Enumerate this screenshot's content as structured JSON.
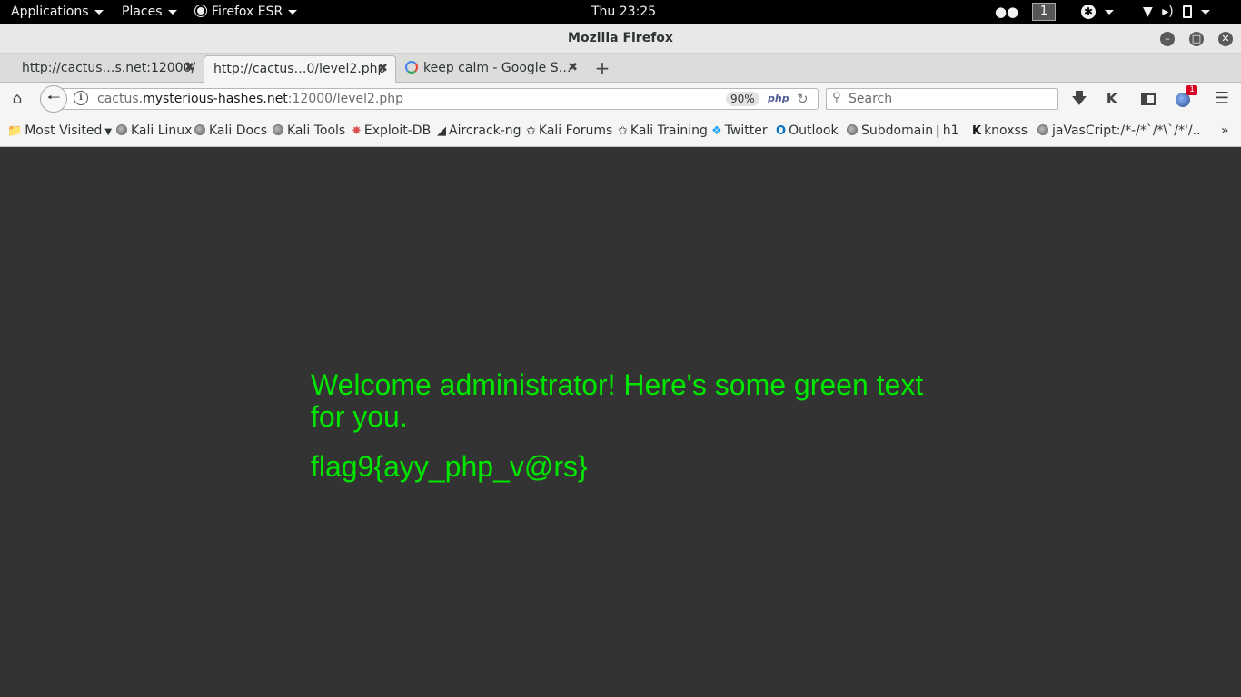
{
  "topbar": {
    "applications": "Applications",
    "places": "Places",
    "firefox_menu": "Firefox ESR",
    "clock": "Thu 23:25",
    "workspace": "1"
  },
  "window": {
    "title": "Mozilla Firefox"
  },
  "tabs": [
    {
      "label": "http://cactus…s.net:12000/"
    },
    {
      "label": "http://cactus…0/level2.php"
    },
    {
      "label": "keep calm - Google S…"
    }
  ],
  "navbar": {
    "url_prefix": "cactus.",
    "url_domain": "mysterious-hashes.net",
    "url_suffix": ":12000/level2.php",
    "zoom": "90%",
    "php_badge": "php",
    "search_placeholder": "Search",
    "notification_count": "1"
  },
  "bookmarks": [
    {
      "label": "Most Visited",
      "icon": "folder-icon"
    },
    {
      "label": "Kali Linux",
      "icon": "globe-icon"
    },
    {
      "label": "Kali Docs",
      "icon": "globe-icon"
    },
    {
      "label": "Kali Tools",
      "icon": "globe-icon"
    },
    {
      "label": "Exploit-DB",
      "icon": "exploit-db-icon"
    },
    {
      "label": "Aircrack-ng",
      "icon": "aircrack-icon"
    },
    {
      "label": "Kali Forums",
      "icon": "kali-dragon-icon"
    },
    {
      "label": "Kali Training",
      "icon": "kali-dragon-icon"
    },
    {
      "label": "Twitter",
      "icon": "twitter-icon"
    },
    {
      "label": "Outlook",
      "icon": "outlook-icon"
    },
    {
      "label": "Subdomain",
      "icon": "globe-icon"
    },
    {
      "label": "h1",
      "icon": "hackerone-icon"
    },
    {
      "label": "knoxss",
      "icon": "knoxss-icon"
    },
    {
      "label": "jaVasCript:/*-/*`/*\\`/*'/...",
      "icon": "globe-icon"
    }
  ],
  "content": {
    "welcome": "Welcome administrator! Here's some green text for you.",
    "flag": "flag9{ayy_php_v@rs}"
  },
  "colors": {
    "page_background": "#333333",
    "text_green": "#00e600",
    "topbar": "#000000"
  }
}
